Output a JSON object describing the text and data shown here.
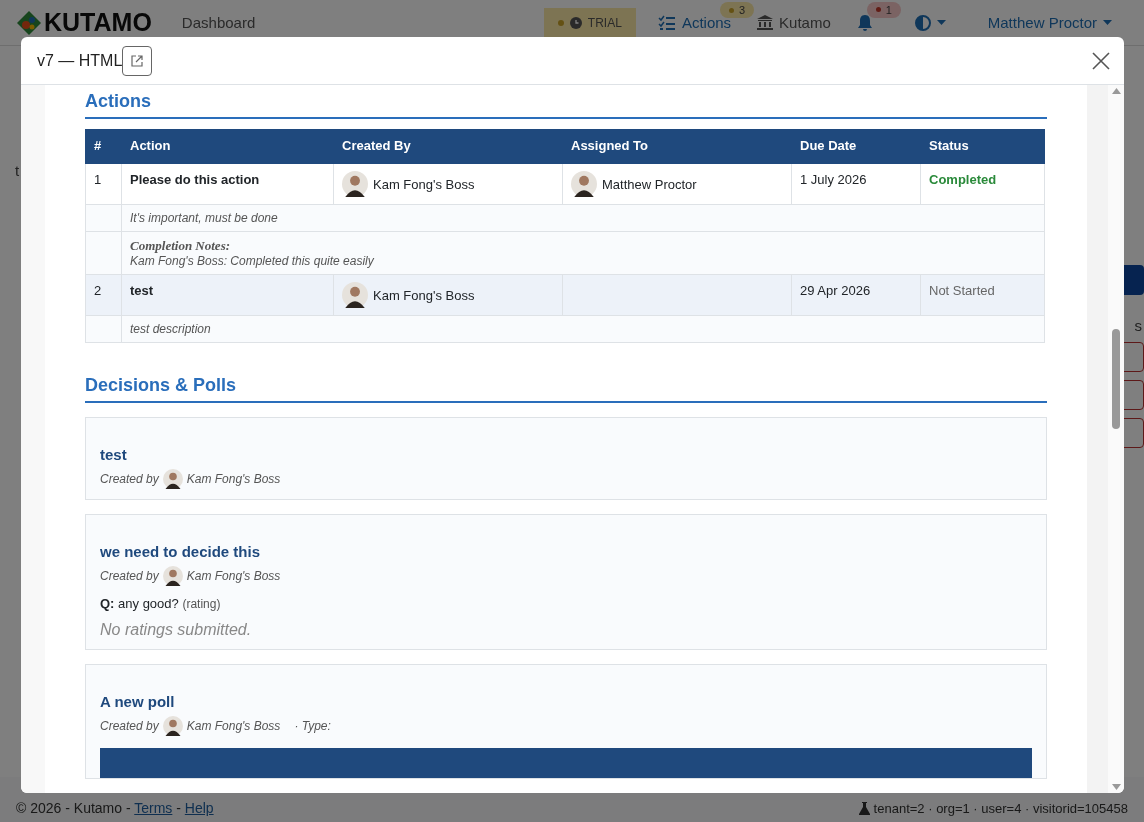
{
  "navbar": {
    "brand": "KUTAMO",
    "dashboard": "Dashboard",
    "trial": "TRIAL",
    "actions": {
      "label": "Actions",
      "badge": "3"
    },
    "org": "Kutamo",
    "notifications_badge": "1",
    "user": "Matthew Proctor"
  },
  "background_page": {
    "left_fragment": "t",
    "right_column_fragment": "s"
  },
  "modal": {
    "title": "v7 — HTML",
    "actions": {
      "heading": "Actions",
      "columns": [
        "#",
        "Action",
        "Created By",
        "Assigned To",
        "Due Date",
        "Status"
      ],
      "rows": [
        {
          "number": "1",
          "action": "Please do this action",
          "created_by": "Kam Fong's Boss",
          "assigned_to": "Matthew Proctor",
          "due_date": "1 July 2026",
          "status": "Completed",
          "color": "#2a8a3a",
          "status_emphasized": true,
          "highlighted": false,
          "description": "It's important, must be done",
          "completion_label": "Completion Notes:",
          "completion_text": "Kam Fong's Boss: Completed this quite easily"
        },
        {
          "number": "2",
          "action": "test",
          "created_by": "Kam Fong's Boss",
          "due_date": "29 Apr 2026",
          "status": "Not Started",
          "color": "#666666",
          "status_emphasized": false,
          "highlighted": true,
          "description": "test description"
        }
      ]
    },
    "decisions": {
      "heading": "Decisions & Polls",
      "items": [
        {
          "title": "test",
          "created_by_label": "Created by",
          "creator": "Kam Fong's Boss"
        },
        {
          "title": "we need to decide this",
          "created_by_label": "Created by",
          "creator": "Kam Fong's Boss",
          "question_label": "Q:",
          "question": "any good?",
          "question_type": "(rating)",
          "empty_text": "No ratings submitted."
        },
        {
          "title": "A new poll",
          "created_by_label": "Created by",
          "creator": "Kam Fong's Boss",
          "type_label": "· Type:",
          "has_table": true
        }
      ]
    }
  },
  "footer": {
    "copyright": "© 2026 - Kutamo - ",
    "terms": "Terms",
    "separator": " - ",
    "help": "Help",
    "debug": "tenant=2 · org=1 · user=4 · visitorid=105458"
  }
}
